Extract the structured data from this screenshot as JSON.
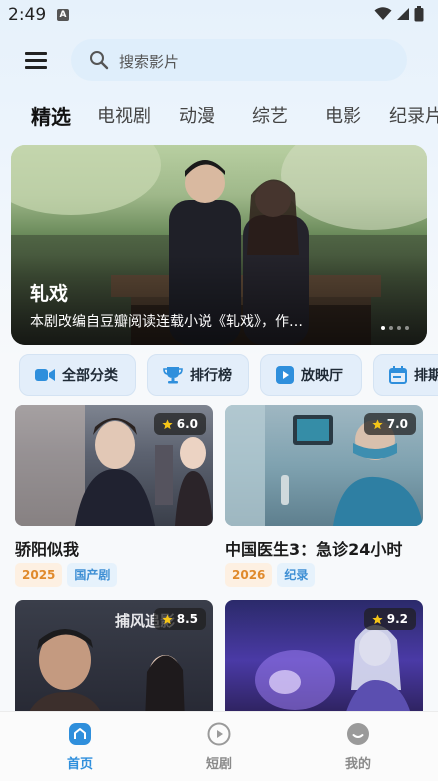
{
  "status": {
    "time": "2:49",
    "notification": "A"
  },
  "search": {
    "placeholder": "搜索影片"
  },
  "tabs": [
    {
      "label": "精选",
      "active": true
    },
    {
      "label": "电视剧"
    },
    {
      "label": "动漫"
    },
    {
      "label": "综艺"
    },
    {
      "label": "电影"
    },
    {
      "label": "纪录片"
    }
  ],
  "banner": {
    "title": "轧戏",
    "description": "本剧改编自豆瓣阅读连载小说《轧戏》，作…",
    "dot_count": 4,
    "active_dot": 0
  },
  "quick_links": [
    {
      "label": "全部分类",
      "icon": "video-camera-icon"
    },
    {
      "label": "排行榜",
      "icon": "trophy-icon"
    },
    {
      "label": "放映厅",
      "icon": "play-icon"
    },
    {
      "label": "排期",
      "icon": "calendar-icon"
    }
  ],
  "cards": [
    {
      "title": "骄阳似我",
      "rating": "6.0",
      "year": "2025",
      "genre": "国产剧"
    },
    {
      "title": "中国医生3：急诊24小时",
      "rating": "7.0",
      "year": "2026",
      "genre": "纪录"
    },
    {
      "title": "",
      "rating": "8.5",
      "poster_text": "捕风追影"
    },
    {
      "title": "",
      "rating": "9.2"
    }
  ],
  "nav": [
    {
      "label": "首页",
      "icon": "home-icon",
      "active": true
    },
    {
      "label": "短剧",
      "icon": "play-circle-icon"
    },
    {
      "label": "我的",
      "icon": "smile-icon"
    }
  ],
  "colors": {
    "accent": "#2f8fdc",
    "year_tag": "#e08a2c",
    "genre_tag": "#3e8fd4",
    "star": "#f5c518"
  }
}
